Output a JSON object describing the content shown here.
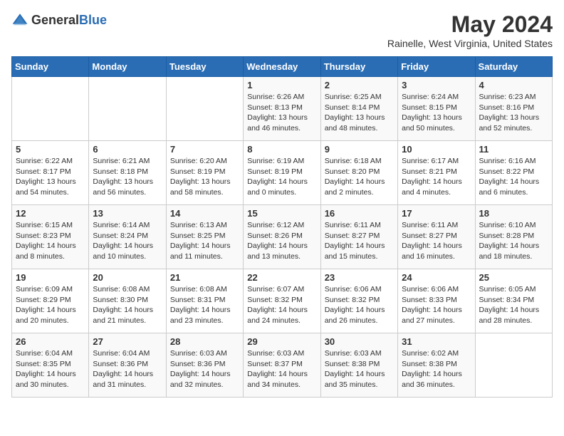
{
  "logo": {
    "general": "General",
    "blue": "Blue"
  },
  "title": "May 2024",
  "subtitle": "Rainelle, West Virginia, United States",
  "days_of_week": [
    "Sunday",
    "Monday",
    "Tuesday",
    "Wednesday",
    "Thursday",
    "Friday",
    "Saturday"
  ],
  "weeks": [
    [
      {
        "day": "",
        "info": ""
      },
      {
        "day": "",
        "info": ""
      },
      {
        "day": "",
        "info": ""
      },
      {
        "day": "1",
        "info": "Sunrise: 6:26 AM\nSunset: 8:13 PM\nDaylight: 13 hours\nand 46 minutes."
      },
      {
        "day": "2",
        "info": "Sunrise: 6:25 AM\nSunset: 8:14 PM\nDaylight: 13 hours\nand 48 minutes."
      },
      {
        "day": "3",
        "info": "Sunrise: 6:24 AM\nSunset: 8:15 PM\nDaylight: 13 hours\nand 50 minutes."
      },
      {
        "day": "4",
        "info": "Sunrise: 6:23 AM\nSunset: 8:16 PM\nDaylight: 13 hours\nand 52 minutes."
      }
    ],
    [
      {
        "day": "5",
        "info": "Sunrise: 6:22 AM\nSunset: 8:17 PM\nDaylight: 13 hours\nand 54 minutes."
      },
      {
        "day": "6",
        "info": "Sunrise: 6:21 AM\nSunset: 8:18 PM\nDaylight: 13 hours\nand 56 minutes."
      },
      {
        "day": "7",
        "info": "Sunrise: 6:20 AM\nSunset: 8:19 PM\nDaylight: 13 hours\nand 58 minutes."
      },
      {
        "day": "8",
        "info": "Sunrise: 6:19 AM\nSunset: 8:19 PM\nDaylight: 14 hours\nand 0 minutes."
      },
      {
        "day": "9",
        "info": "Sunrise: 6:18 AM\nSunset: 8:20 PM\nDaylight: 14 hours\nand 2 minutes."
      },
      {
        "day": "10",
        "info": "Sunrise: 6:17 AM\nSunset: 8:21 PM\nDaylight: 14 hours\nand 4 minutes."
      },
      {
        "day": "11",
        "info": "Sunrise: 6:16 AM\nSunset: 8:22 PM\nDaylight: 14 hours\nand 6 minutes."
      }
    ],
    [
      {
        "day": "12",
        "info": "Sunrise: 6:15 AM\nSunset: 8:23 PM\nDaylight: 14 hours\nand 8 minutes."
      },
      {
        "day": "13",
        "info": "Sunrise: 6:14 AM\nSunset: 8:24 PM\nDaylight: 14 hours\nand 10 minutes."
      },
      {
        "day": "14",
        "info": "Sunrise: 6:13 AM\nSunset: 8:25 PM\nDaylight: 14 hours\nand 11 minutes."
      },
      {
        "day": "15",
        "info": "Sunrise: 6:12 AM\nSunset: 8:26 PM\nDaylight: 14 hours\nand 13 minutes."
      },
      {
        "day": "16",
        "info": "Sunrise: 6:11 AM\nSunset: 8:27 PM\nDaylight: 14 hours\nand 15 minutes."
      },
      {
        "day": "17",
        "info": "Sunrise: 6:11 AM\nSunset: 8:27 PM\nDaylight: 14 hours\nand 16 minutes."
      },
      {
        "day": "18",
        "info": "Sunrise: 6:10 AM\nSunset: 8:28 PM\nDaylight: 14 hours\nand 18 minutes."
      }
    ],
    [
      {
        "day": "19",
        "info": "Sunrise: 6:09 AM\nSunset: 8:29 PM\nDaylight: 14 hours\nand 20 minutes."
      },
      {
        "day": "20",
        "info": "Sunrise: 6:08 AM\nSunset: 8:30 PM\nDaylight: 14 hours\nand 21 minutes."
      },
      {
        "day": "21",
        "info": "Sunrise: 6:08 AM\nSunset: 8:31 PM\nDaylight: 14 hours\nand 23 minutes."
      },
      {
        "day": "22",
        "info": "Sunrise: 6:07 AM\nSunset: 8:32 PM\nDaylight: 14 hours\nand 24 minutes."
      },
      {
        "day": "23",
        "info": "Sunrise: 6:06 AM\nSunset: 8:32 PM\nDaylight: 14 hours\nand 26 minutes."
      },
      {
        "day": "24",
        "info": "Sunrise: 6:06 AM\nSunset: 8:33 PM\nDaylight: 14 hours\nand 27 minutes."
      },
      {
        "day": "25",
        "info": "Sunrise: 6:05 AM\nSunset: 8:34 PM\nDaylight: 14 hours\nand 28 minutes."
      }
    ],
    [
      {
        "day": "26",
        "info": "Sunrise: 6:04 AM\nSunset: 8:35 PM\nDaylight: 14 hours\nand 30 minutes."
      },
      {
        "day": "27",
        "info": "Sunrise: 6:04 AM\nSunset: 8:36 PM\nDaylight: 14 hours\nand 31 minutes."
      },
      {
        "day": "28",
        "info": "Sunrise: 6:03 AM\nSunset: 8:36 PM\nDaylight: 14 hours\nand 32 minutes."
      },
      {
        "day": "29",
        "info": "Sunrise: 6:03 AM\nSunset: 8:37 PM\nDaylight: 14 hours\nand 34 minutes."
      },
      {
        "day": "30",
        "info": "Sunrise: 6:03 AM\nSunset: 8:38 PM\nDaylight: 14 hours\nand 35 minutes."
      },
      {
        "day": "31",
        "info": "Sunrise: 6:02 AM\nSunset: 8:38 PM\nDaylight: 14 hours\nand 36 minutes."
      },
      {
        "day": "",
        "info": ""
      }
    ]
  ]
}
